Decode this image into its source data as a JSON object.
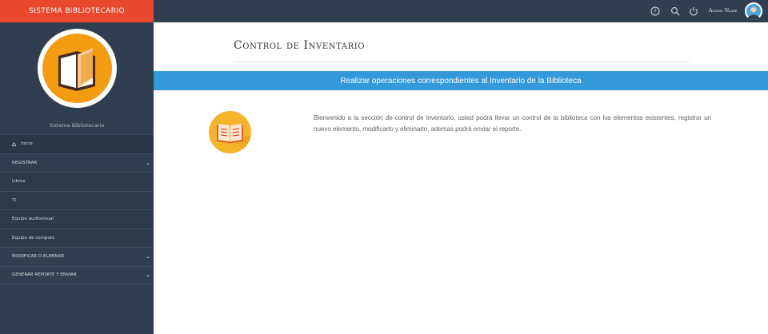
{
  "brand": {
    "title": "SISTEMA BIBLIOTECARIO"
  },
  "sidebar": {
    "user_label": "Sistema Bibliotecario",
    "items": [
      {
        "label": "Inicio",
        "icon": "home-icon"
      },
      {
        "label": "REGISTRAR",
        "icon": "chevron-down-icon"
      },
      {
        "label": "Libros"
      },
      {
        "label": "TI"
      },
      {
        "label": "Equipo audiovisual"
      },
      {
        "label": "Equipo de computo"
      },
      {
        "label": "MODIFICAR O ELIMINAR",
        "icon": "chevron-down-icon"
      },
      {
        "label": "GENERAR REPORTE Y ENVIAR",
        "icon": "chevron-down-icon"
      }
    ]
  },
  "topbar": {
    "help_icon": "help-circle-icon",
    "search_icon": "search-icon",
    "power_icon": "power-icon",
    "admin_name": "Admin Name"
  },
  "main": {
    "title": "Control de Inventario",
    "banner": "Realizar operaciones correspondientes al Inventario de la Biblioteca",
    "intro": "Bienvenido a la sección de control de inventario, usted podrá llevar un control de la biblioteca con los elementos existentes, registrar un nuevo elemento, modificarlo y eliminarlo, ademas podrá enviar el reporte."
  },
  "colors": {
    "sidebar_bg": "#2f3e50",
    "brand_bg": "#e9482d",
    "banner_bg": "#3399d9",
    "accent_orange": "#f39c12"
  }
}
